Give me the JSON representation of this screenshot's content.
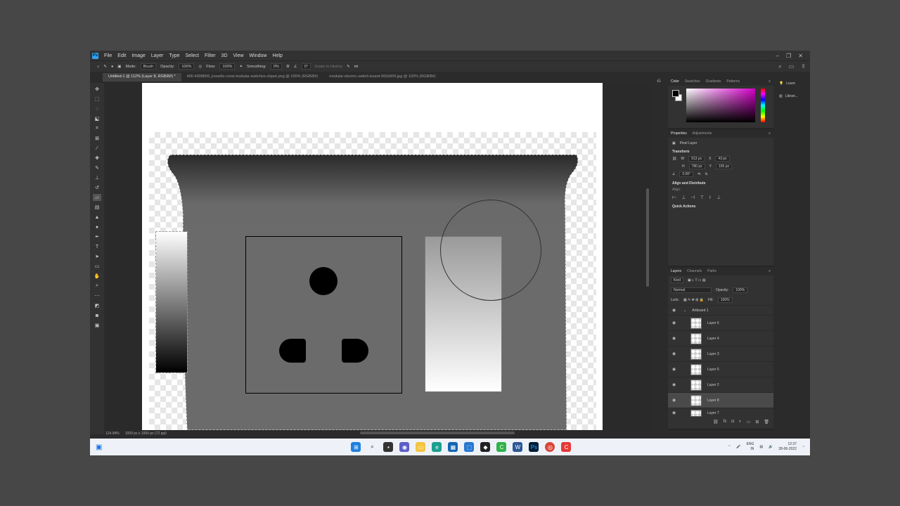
{
  "app": {
    "logo": "Ps"
  },
  "menu": [
    "File",
    "Edit",
    "Image",
    "Layer",
    "Type",
    "Select",
    "Filter",
    "3D",
    "View",
    "Window",
    "Help"
  ],
  "window_controls": {
    "minimize": "–",
    "restore": "❐",
    "close": "✕"
  },
  "options_bar": {
    "mode_label": "Mode:",
    "mode_value": "Brush",
    "opacity_label": "Opacity:",
    "opacity_value": "100%",
    "flow_label": "Flow:",
    "flow_value": "100%",
    "smoothing_label": "Smoothing:",
    "smoothing_value": "0%",
    "angle_value": "0°",
    "erase_label": "Erase to History"
  },
  "doc_tabs": [
    "Untitled-1 @ 112% (Layer 8, RGB/8#) *",
    "490-4908809_kowells-coral-modular-switches-clipart.png @ 100% (RGB/8#)",
    "modular-electric-switch-board-500x500.jpg @ 100% (RGB/8#)"
  ],
  "status": {
    "zoom": "124.94%",
    "doc_size": "1000 px x 1000 px (72 ppi)"
  },
  "color_panel": {
    "tabs": [
      "Color",
      "Swatches",
      "Gradients",
      "Patterns"
    ],
    "fg": "#000000",
    "bg": "#ffffff"
  },
  "properties_panel": {
    "tabs": [
      "Properties",
      "Adjustments"
    ],
    "kind": "Pixel Layer",
    "transform_heading": "Transform",
    "w": "913 px",
    "x": "43 px",
    "h": "780 px",
    "y": "155 px",
    "angle": "0.00°",
    "align_heading": "Align and Distribute",
    "align_label": "Align:",
    "quick_actions": "Quick Actions"
  },
  "layers_panel": {
    "tabs": [
      "Layers",
      "Channels",
      "Paths"
    ],
    "filter": "Kind",
    "blend": "Normal",
    "opacity_label": "Opacity:",
    "opacity": "100%",
    "lock_label": "Lock:",
    "fill_label": "Fill:",
    "fill": "100%",
    "group": "Artboard 1",
    "layers": [
      {
        "name": "Layer 6",
        "selected": false
      },
      {
        "name": "Layer 4",
        "selected": false
      },
      {
        "name": "Layer 3",
        "selected": false
      },
      {
        "name": "Layer 5",
        "selected": false
      },
      {
        "name": "Layer 2",
        "selected": false
      },
      {
        "name": "Layer 8",
        "selected": true
      },
      {
        "name": "Layer 7",
        "selected": false
      }
    ]
  },
  "learn_panel": {
    "learn": "Learn",
    "libraries": "Librari..."
  },
  "taskbar": {
    "tray": {
      "lang_top": "ENG",
      "lang_bottom": "IN",
      "time": "12:37",
      "date": "28-06-2022"
    }
  }
}
